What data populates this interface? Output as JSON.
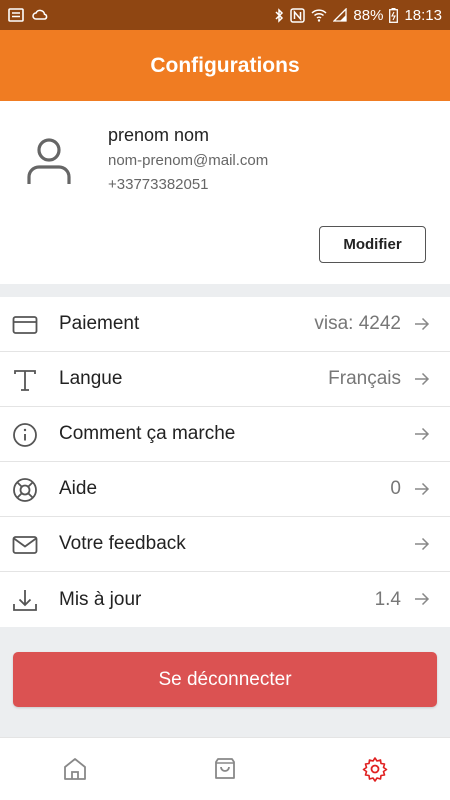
{
  "status_bar": {
    "battery": "88%",
    "time": "18:13"
  },
  "header": {
    "title": "Configurations"
  },
  "profile": {
    "name": "prenom nom",
    "email": "nom-prenom@mail.com",
    "phone": "+33773382051",
    "edit_label": "Modifier"
  },
  "menu": {
    "items": [
      {
        "icon": "credit-card-icon",
        "label": "Paiement",
        "value": "visa: 4242"
      },
      {
        "icon": "text-type-icon",
        "label": "Langue",
        "value": "Français"
      },
      {
        "icon": "info-icon",
        "label": "Comment ça marche",
        "value": ""
      },
      {
        "icon": "help-lifebuoy-icon",
        "label": "Aide",
        "value": "0"
      },
      {
        "icon": "mail-icon",
        "label": "Votre feedback",
        "value": ""
      },
      {
        "icon": "download-icon",
        "label": "Mis à jour",
        "value": "1.4"
      }
    ]
  },
  "logout": {
    "label": "Se déconnecter"
  },
  "colors": {
    "header": "#f07c22",
    "status_bar": "#8f4612",
    "logout": "#db5252",
    "active_nav": "#e02020"
  },
  "bottom_nav": {
    "items": [
      {
        "icon": "home-icon",
        "active": false
      },
      {
        "icon": "shopping-bag-icon",
        "active": false
      },
      {
        "icon": "settings-gear-icon",
        "active": true
      }
    ]
  }
}
